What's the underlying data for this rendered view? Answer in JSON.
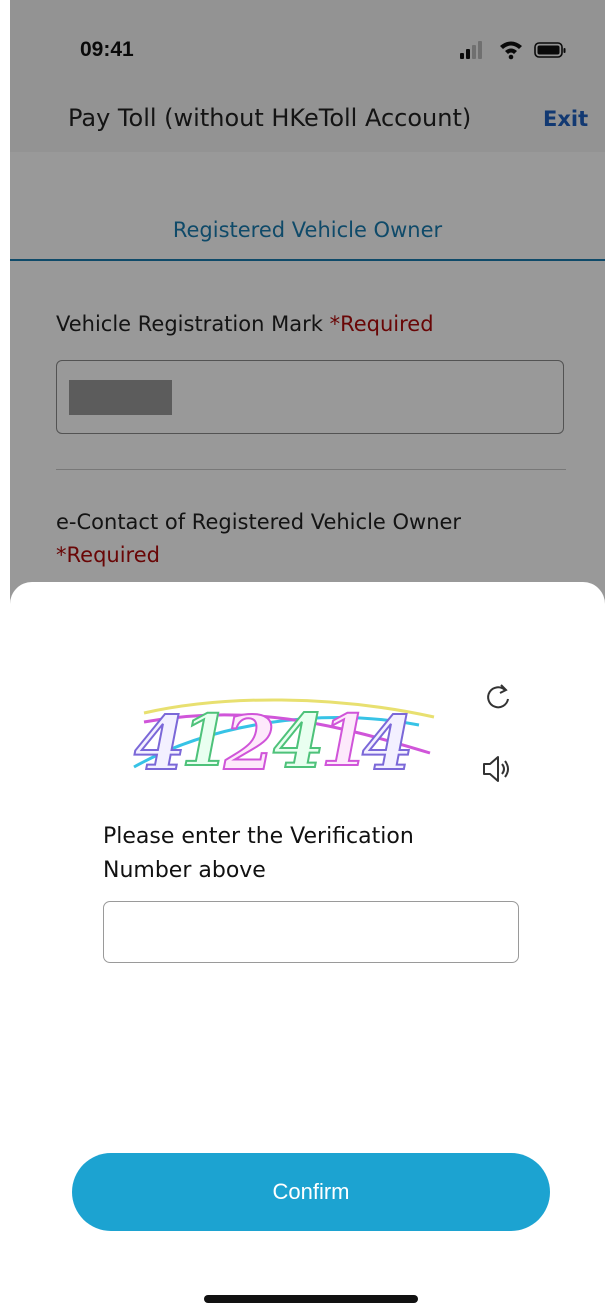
{
  "status_bar": {
    "time": "09:41"
  },
  "nav": {
    "title": "Pay Toll (without HKeToll Account)",
    "exit_label": "Exit"
  },
  "tab": {
    "label": "Registered Vehicle Owner"
  },
  "form": {
    "vrm_label": "Vehicle Registration Mark",
    "vrm_required": "*Required",
    "contact_label": "e-Contact of Registered Vehicle Owner",
    "contact_required": "*Required"
  },
  "verification": {
    "captcha_text": "412414",
    "prompt": "Please enter the Verification Number above",
    "input_value": "",
    "confirm_label": "Confirm"
  },
  "icons": [
    "refresh-icon",
    "speaker-icon",
    "signal-icon",
    "wifi-icon",
    "battery-icon"
  ],
  "colors": {
    "accent": "#1ca3d1",
    "tab": "#1a7cb0",
    "required": "#b00a0a",
    "exit": "#1f5fbf",
    "side_arrow": "#1ba38b"
  }
}
